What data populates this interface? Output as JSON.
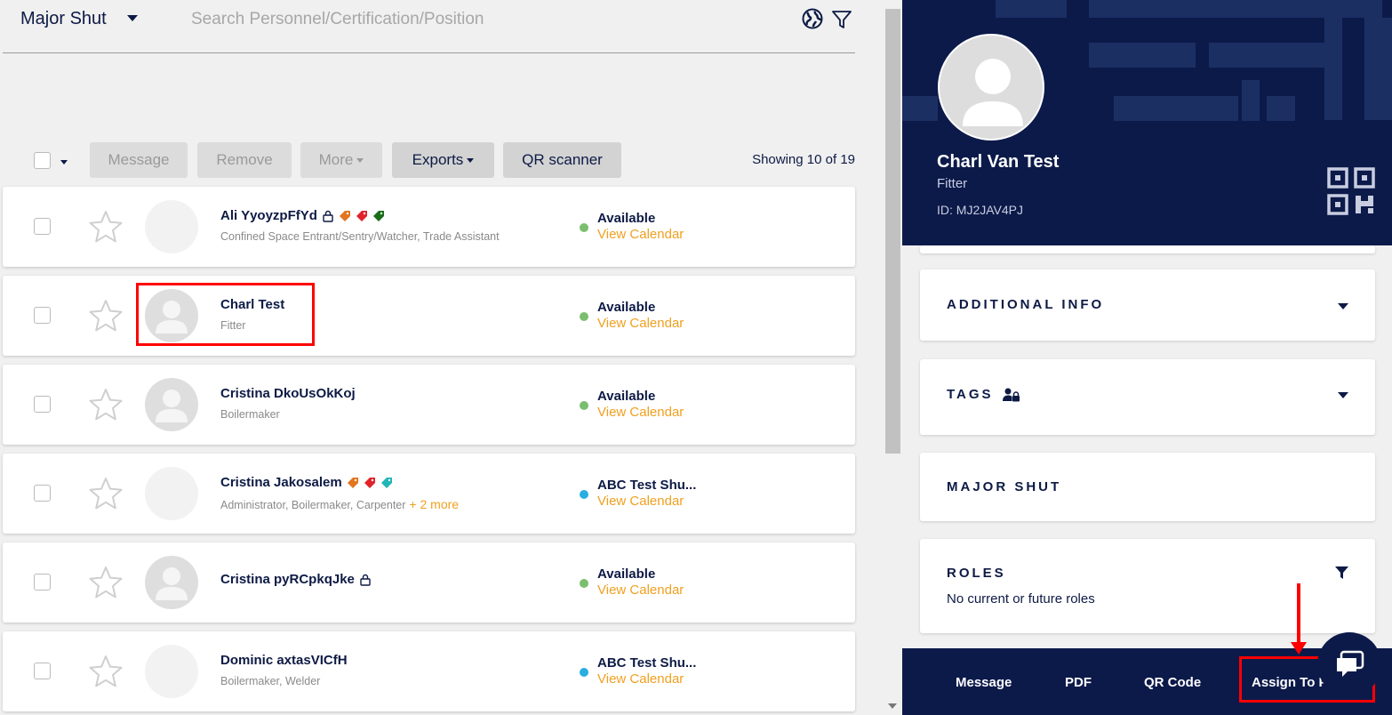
{
  "header": {
    "project_name": "Major Shut",
    "search_placeholder": "Search Personnel/Certification/Position"
  },
  "toolbar": {
    "message_label": "Message",
    "remove_label": "Remove",
    "more_label": "More",
    "exports_label": "Exports",
    "qr_scanner_label": "QR scanner",
    "showing_text": "Showing 10 of 19"
  },
  "personnel": [
    {
      "name": "Ali YyoyzpFfYd",
      "positions": "Confined Space Entrant/Sentry/Watcher, Trade Assistant",
      "more": "",
      "status": "Available",
      "status_color": "#7bbf6e",
      "calendar_label": "View Calendar"
    },
    {
      "name": "Charl Test",
      "positions": "Fitter",
      "more": "",
      "status": "Available",
      "status_color": "#7bbf6e",
      "calendar_label": "View Calendar"
    },
    {
      "name": "Cristina DkoUsOkKoj",
      "positions": "Boilermaker",
      "more": "",
      "status": "Available",
      "status_color": "#7bbf6e",
      "calendar_label": "View Calendar"
    },
    {
      "name": "Cristina Jakosalem",
      "positions": "Administrator, Boilermaker, Carpenter",
      "more": "+ 2 more",
      "status": "ABC Test Shu...",
      "status_color": "#29aee0",
      "calendar_label": "View Calendar"
    },
    {
      "name": "Cristina pyRCpkqJke",
      "positions": "",
      "more": "",
      "status": "Available",
      "status_color": "#7bbf6e",
      "calendar_label": "View Calendar"
    },
    {
      "name": "Dominic axtasVICfH",
      "positions": "Boilermaker, Welder",
      "more": "",
      "status": "ABC Test Shu...",
      "status_color": "#29aee0",
      "calendar_label": "View Calendar"
    }
  ],
  "profile": {
    "name": "Charl Van Test",
    "role": "Fitter",
    "id_text": "ID: MJ2JAV4PJ"
  },
  "sections": {
    "additional_info": "ADDITIONAL INFO",
    "tags": "TAGS",
    "major_shut": "MAJOR SHUT",
    "roles": "ROLES",
    "roles_empty": "No current or future roles"
  },
  "bottom_bar": {
    "message": "Message",
    "pdf": "PDF",
    "qr_code": "QR Code",
    "assign": "Assign To P..."
  },
  "colors": {
    "navy": "#0c1a4a",
    "accent_orange": "#f0a020",
    "highlight_red": "#ff0000"
  }
}
